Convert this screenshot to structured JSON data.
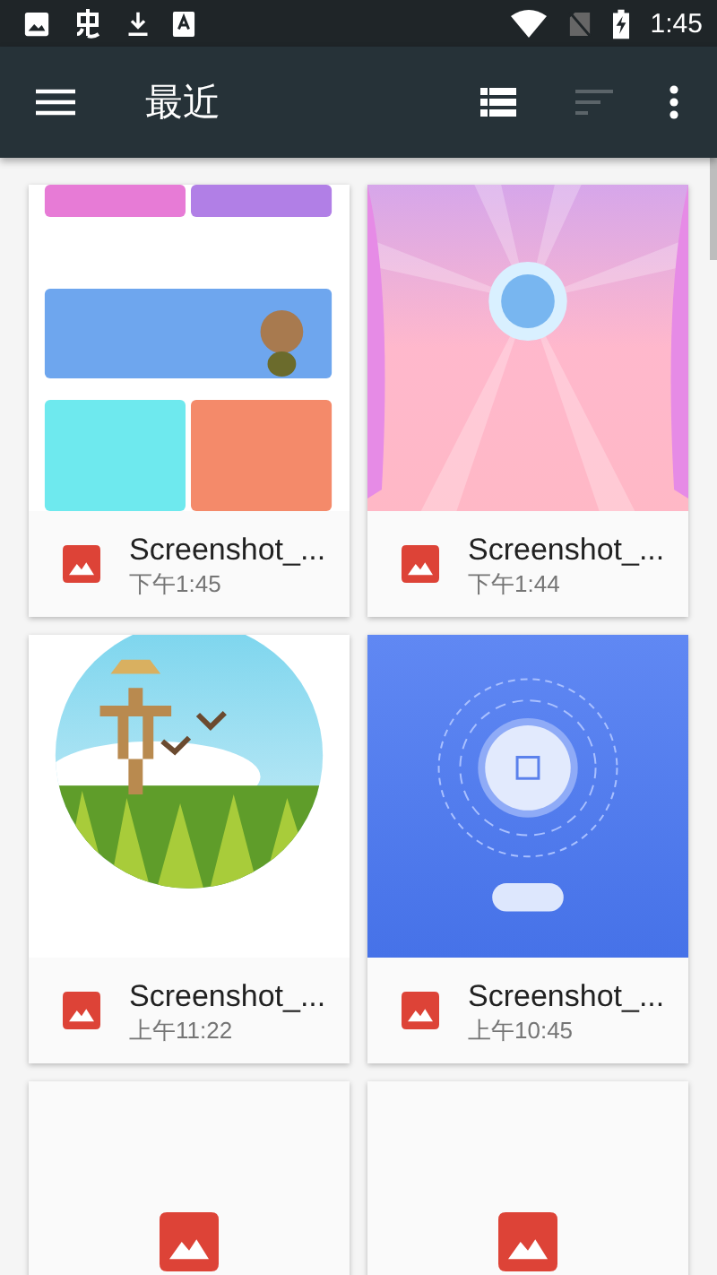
{
  "status_bar": {
    "time": "1:45"
  },
  "toolbar": {
    "title": "最近",
    "sort_disabled": true
  },
  "files": [
    {
      "kind": "picture",
      "name": "Screenshot_...",
      "time": "下午1:45"
    },
    {
      "kind": "picture",
      "name": "Screenshot_...",
      "time": "下午1:44"
    },
    {
      "kind": "picture",
      "name": "Screenshot_...",
      "time": "上午11:22"
    },
    {
      "kind": "picture",
      "name": "Screenshot_...",
      "time": "上午10:45"
    },
    {
      "kind": "placeholder"
    },
    {
      "kind": "placeholder"
    }
  ]
}
